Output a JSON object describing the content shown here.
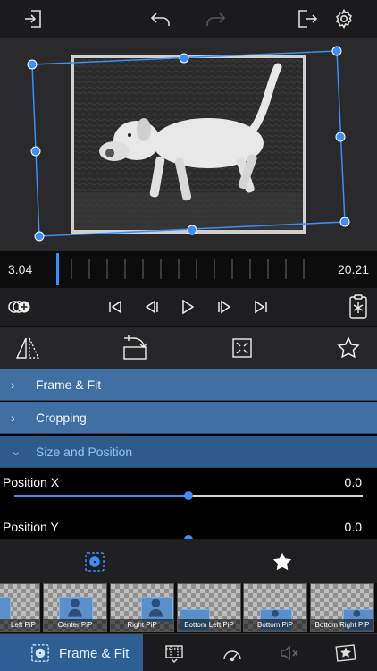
{
  "timeline": {
    "start_time": "3.04",
    "end_time": "20.21",
    "playhead_position": 0.02
  },
  "sections": [
    {
      "label": "Frame & Fit",
      "chevron": "›",
      "expanded": false
    },
    {
      "label": "Cropping",
      "chevron": "›",
      "expanded": false
    },
    {
      "label": "Size and Position",
      "chevron": "⌄",
      "expanded": true
    }
  ],
  "sliders": [
    {
      "label": "Position X",
      "value": "0.0",
      "fraction": 0.5
    },
    {
      "label": "Position Y",
      "value": "0.0",
      "fraction": 0.5
    }
  ],
  "presets": [
    {
      "label": "Left PiP"
    },
    {
      "label": "Center PiP"
    },
    {
      "label": "Right PiP"
    },
    {
      "label": "Bottom Left PiP"
    },
    {
      "label": "Bottom PiP"
    },
    {
      "label": "Bottom Right PiP"
    }
  ],
  "bottom_tabs": {
    "active_label": "Frame & Fit"
  },
  "colors": {
    "accent": "#3d8ef5",
    "section": "#3f6fa3",
    "section_active_text": "#8fc3ff",
    "tab_active": "#2d5f95"
  },
  "icons": {
    "topbar": [
      "import-icon",
      "undo-icon",
      "redo-icon",
      "export-icon",
      "settings-gear-icon"
    ],
    "transport": [
      "add-clip-icon",
      "skip-to-start-icon",
      "step-back-icon",
      "play-icon",
      "step-forward-icon",
      "skip-to-end-icon",
      "freeze-frame-icon"
    ],
    "tools": [
      "flip-icon",
      "rotate-icon",
      "fit-to-frame-icon",
      "favorite-star-icon"
    ],
    "presets_bar": [
      "presets-icon",
      "favorites-star-icon"
    ],
    "bottom_tabs": [
      "frame-fit-icon",
      "crop-icon",
      "speed-icon",
      "mute-icon",
      "effects-icon"
    ]
  }
}
